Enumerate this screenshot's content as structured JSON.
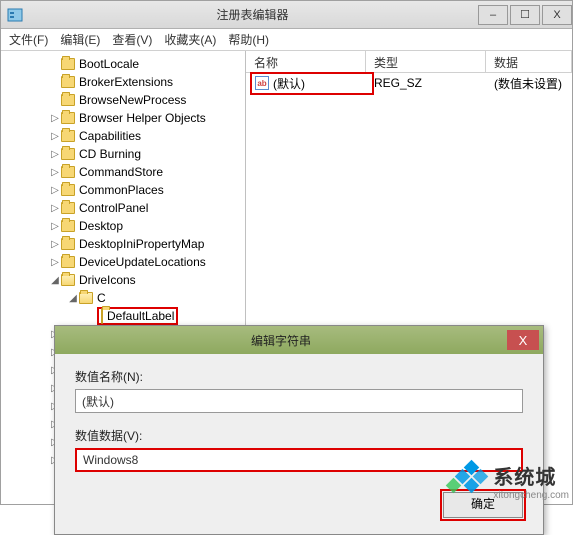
{
  "window": {
    "title": "注册表编辑器",
    "buttons": {
      "min": "–",
      "max": "☐",
      "close": "X"
    }
  },
  "menu": {
    "file": "文件(F)",
    "edit": "编辑(E)",
    "view": "查看(V)",
    "fav": "收藏夹(A)",
    "help": "帮助(H)"
  },
  "tree": {
    "items": [
      {
        "indent": 48,
        "expander": "",
        "label": "BootLocale"
      },
      {
        "indent": 48,
        "expander": "",
        "label": "BrokerExtensions"
      },
      {
        "indent": 48,
        "expander": "",
        "label": "BrowseNewProcess"
      },
      {
        "indent": 48,
        "expander": "▷",
        "label": "Browser Helper Objects"
      },
      {
        "indent": 48,
        "expander": "▷",
        "label": "Capabilities"
      },
      {
        "indent": 48,
        "expander": "▷",
        "label": "CD Burning"
      },
      {
        "indent": 48,
        "expander": "▷",
        "label": "CommandStore"
      },
      {
        "indent": 48,
        "expander": "▷",
        "label": "CommonPlaces"
      },
      {
        "indent": 48,
        "expander": "▷",
        "label": "ControlPanel"
      },
      {
        "indent": 48,
        "expander": "▷",
        "label": "Desktop"
      },
      {
        "indent": 48,
        "expander": "▷",
        "label": "DesktopIniPropertyMap"
      },
      {
        "indent": 48,
        "expander": "▷",
        "label": "DeviceUpdateLocations"
      },
      {
        "indent": 48,
        "expander": "◢",
        "label": "DriveIcons",
        "open": true
      },
      {
        "indent": 66,
        "expander": "◢",
        "label": "C",
        "open": true
      },
      {
        "indent": 84,
        "expander": "",
        "label": "DefaultLabel",
        "highlight": true,
        "open": true
      },
      {
        "indent": 48,
        "expander": "▷",
        "label": ""
      },
      {
        "indent": 48,
        "expander": "▷",
        "label": ""
      },
      {
        "indent": 48,
        "expander": "▷",
        "label": ""
      },
      {
        "indent": 48,
        "expander": "▷",
        "label": ""
      },
      {
        "indent": 48,
        "expander": "▷",
        "label": ""
      },
      {
        "indent": 48,
        "expander": "▷",
        "label": ""
      },
      {
        "indent": 48,
        "expander": "▷",
        "label": ""
      },
      {
        "indent": 48,
        "expander": "▷",
        "label": ""
      }
    ]
  },
  "list": {
    "headers": {
      "name": "名称",
      "type": "类型",
      "data": "数据"
    },
    "row": {
      "icon": "ab",
      "name": "(默认)",
      "type": "REG_SZ",
      "data": "(数值未设置)"
    }
  },
  "dialog": {
    "title": "编辑字符串",
    "close": "X",
    "name_label": "数值名称(N):",
    "name_value": "(默认)",
    "data_label": "数值数据(V):",
    "data_value": "Windows8",
    "ok": "确定"
  },
  "watermark": {
    "brand": "系统城",
    "url": "xitongcheng.com"
  }
}
